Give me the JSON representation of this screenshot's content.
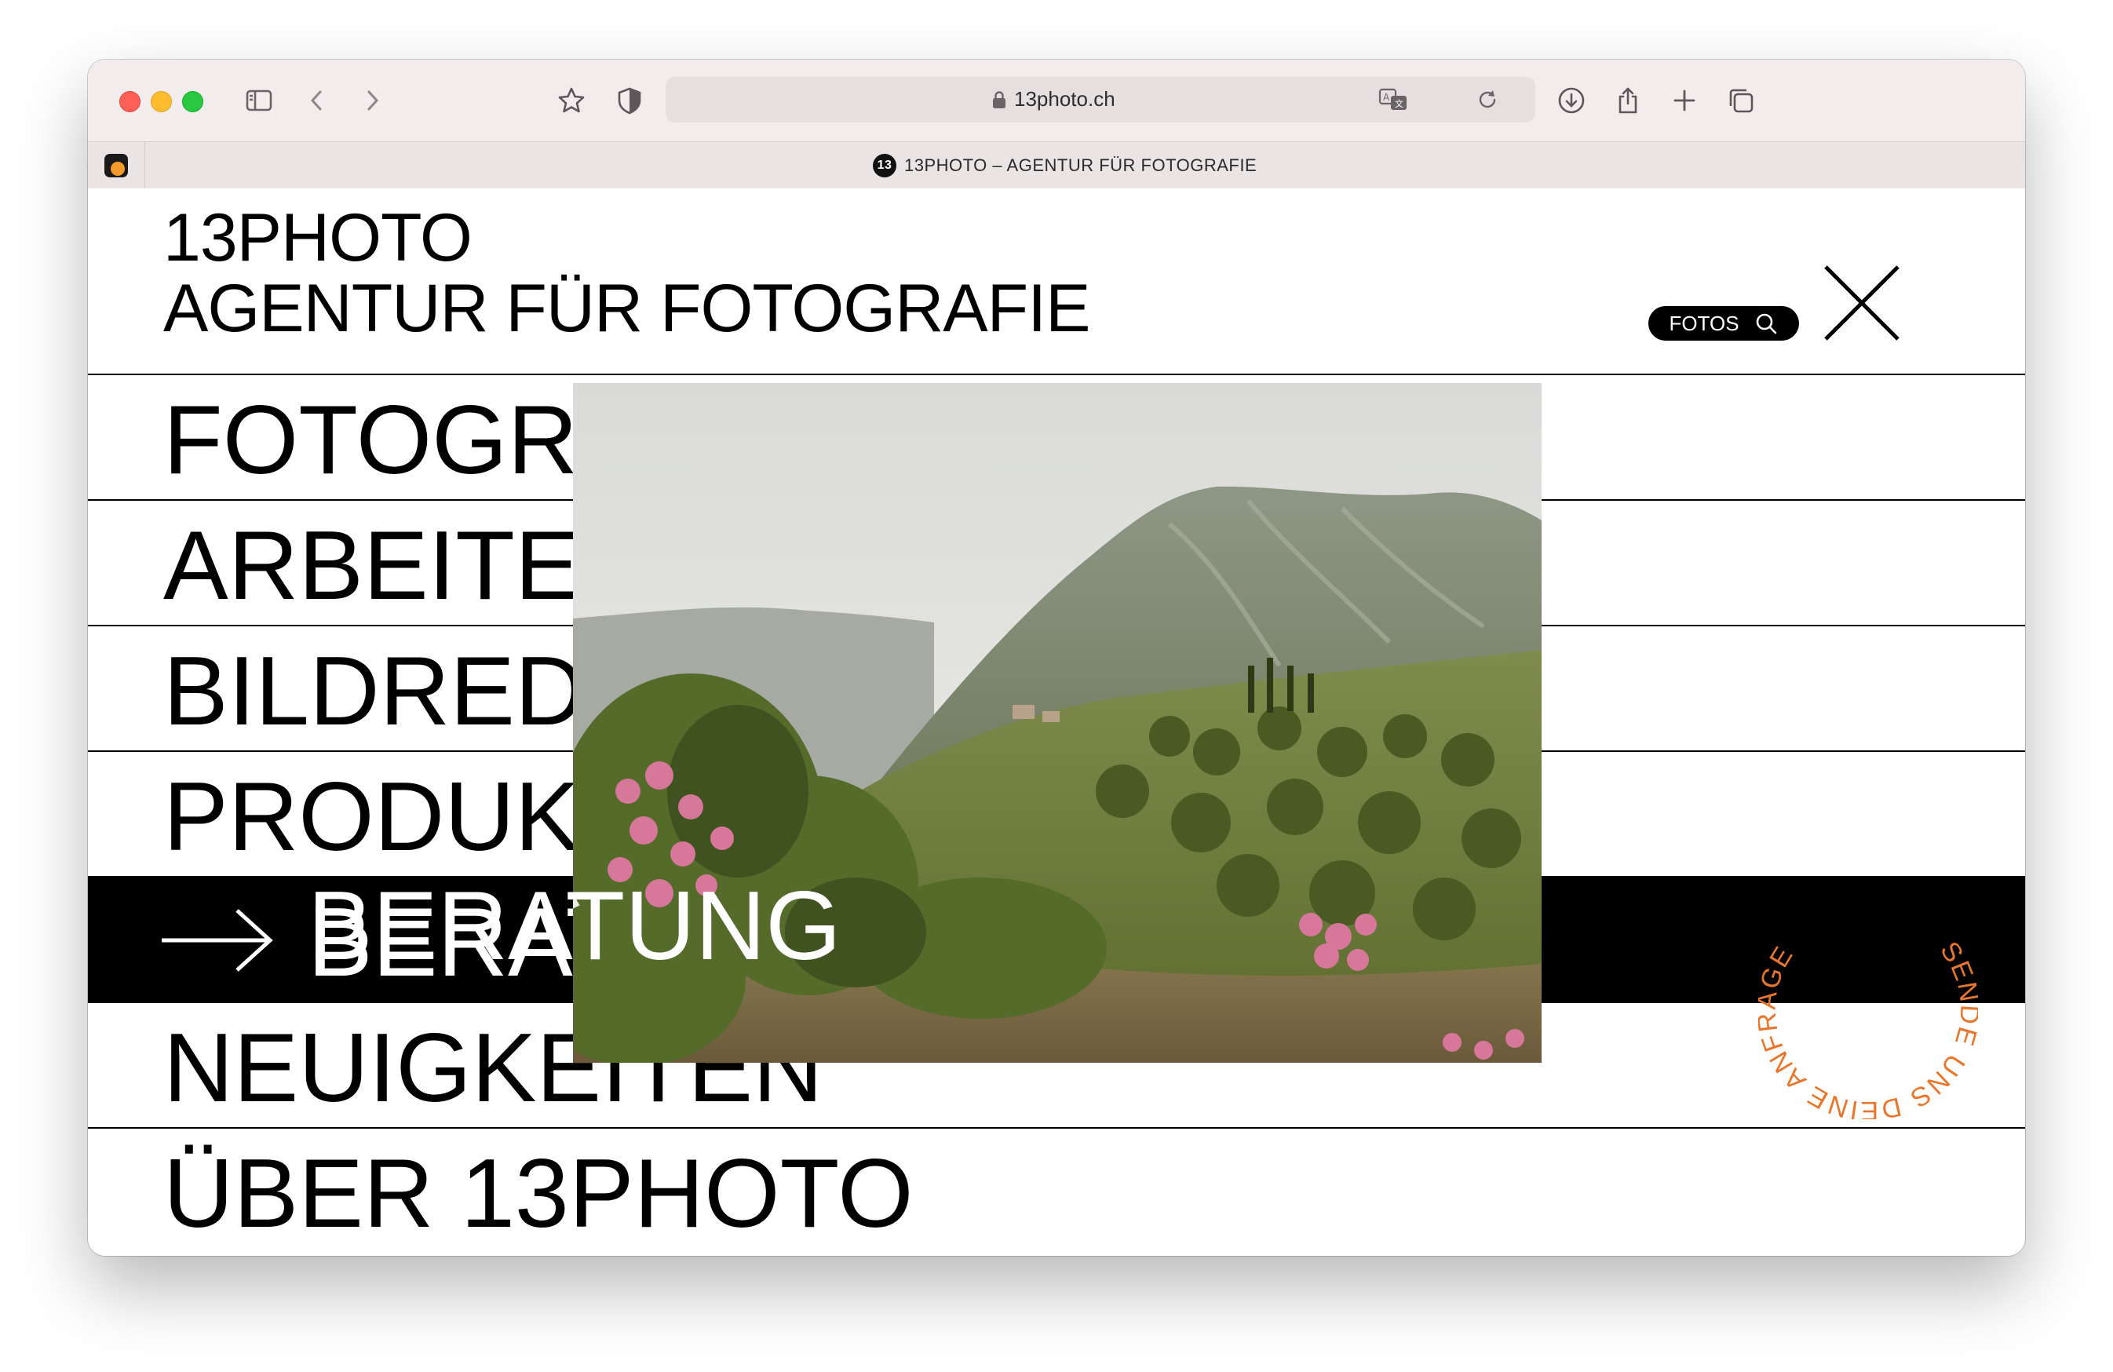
{
  "browser": {
    "url": "13photo.ch",
    "tab_title": "13PHOTO – AGENTUR FÜR FOTOGRAFIE",
    "tab_favicon_text": "13"
  },
  "header": {
    "brand_line1": "13PHOTO",
    "brand_line2": "AGENTUR FÜR FOTOGRAFIE",
    "search_button_label": "FOTOS"
  },
  "menu": {
    "items": [
      {
        "label": "FOTOGRAFIE"
      },
      {
        "label": "ARBEITEN"
      },
      {
        "label": "BILDREDAKTION"
      },
      {
        "label": "PRODUKTION"
      },
      {
        "label": "BERATUNG",
        "active": true
      },
      {
        "label": "NEUIGKEITEN"
      },
      {
        "label": "ÜBER 13PHOTO"
      }
    ]
  },
  "stamp": {
    "text": "SENDE UNS DEINE ANFRAGE",
    "color": "#e8772e"
  },
  "icons": {
    "sidebar": "sidebar-icon",
    "back": "chevron-left-icon",
    "forward": "chevron-right-icon",
    "bookmark": "star-icon",
    "privacy": "shield-icon",
    "translate": "translate-icon",
    "reload": "reload-icon",
    "downloads": "download-icon",
    "share": "share-icon",
    "new_tab": "plus-icon",
    "tabs_overview": "tabs-icon",
    "close_menu": "close-icon",
    "search": "search-icon",
    "arrow": "arrow-right-icon"
  }
}
